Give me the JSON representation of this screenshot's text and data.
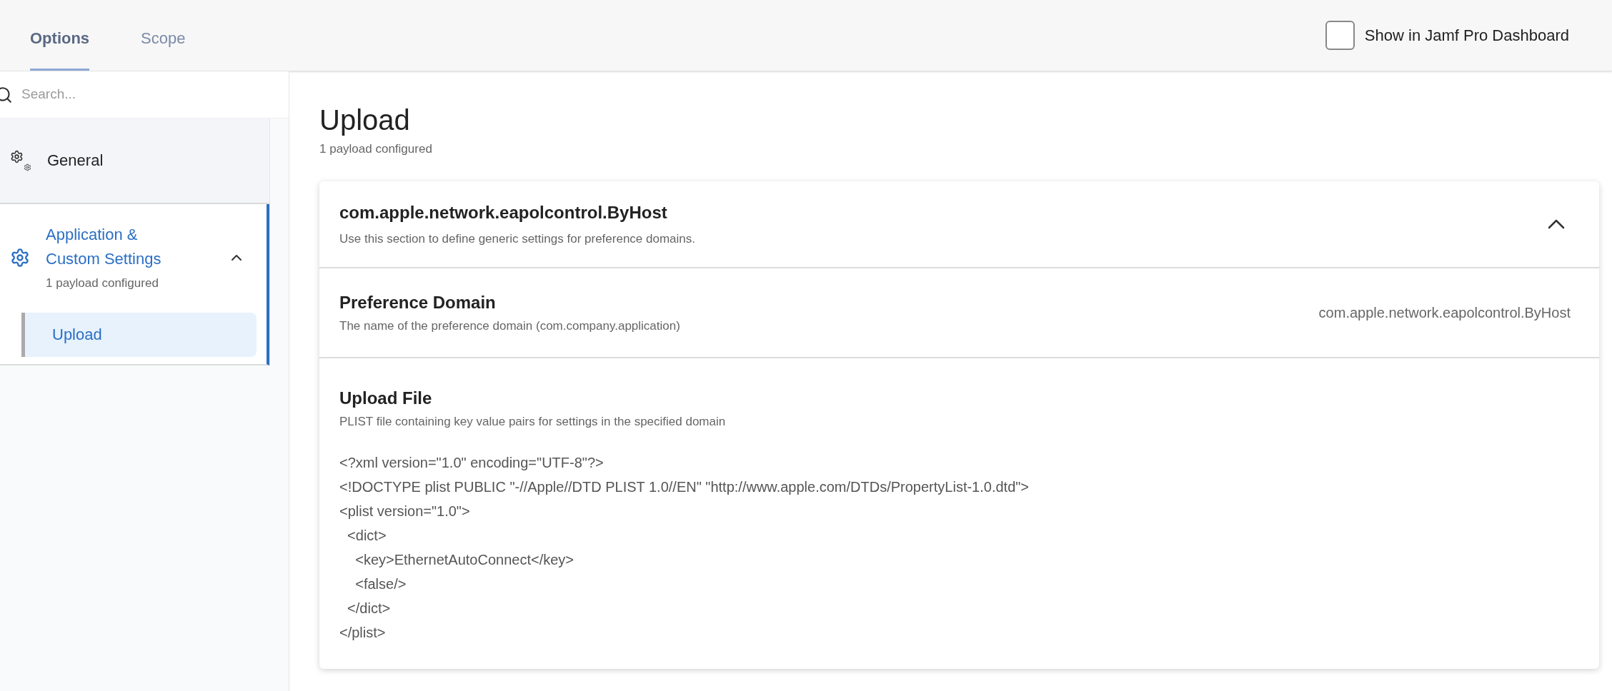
{
  "tabs": [
    {
      "label": "Options",
      "selected": true
    },
    {
      "label": "Scope",
      "selected": false
    }
  ],
  "dashboard_checkbox": {
    "label": "Show in Jamf Pro Dashboard",
    "checked": false
  },
  "sidebar": {
    "search": {
      "placeholder": "Search..."
    },
    "items": [
      {
        "label": "General",
        "selected": false
      },
      {
        "label": "Application & Custom Settings",
        "subtitle": "1 payload configured",
        "selected": true,
        "expanded": true,
        "children": [
          {
            "label": "Upload",
            "selected": true
          }
        ]
      }
    ]
  },
  "main": {
    "title": "Upload",
    "subtitle": "1 payload configured",
    "card": {
      "title": "com.apple.network.eapolcontrol.ByHost",
      "description": "Use this section to define generic settings for preference domains.",
      "expanded": true,
      "fields": [
        {
          "kind": "text",
          "label": "Preference Domain",
          "description": "The name of the preference domain (com.company.application)",
          "value": "com.apple.network.eapolcontrol.ByHost"
        },
        {
          "kind": "file",
          "label": "Upload File",
          "description": "PLIST file containing key value pairs for settings in the specified domain",
          "lines": [
            "<?xml version=\"1.0\" encoding=\"UTF-8\"?>",
            "<!DOCTYPE plist PUBLIC \"-//Apple//DTD PLIST 1.0//EN\" \"http://www.apple.com/DTDs/PropertyList-1.0.dtd\">",
            "<plist version=\"1.0\">",
            "  <dict>",
            "    <key>EthernetAutoConnect</key>",
            "    <false/>",
            "  </dict>",
            "</plist>"
          ]
        }
      ]
    }
  }
}
